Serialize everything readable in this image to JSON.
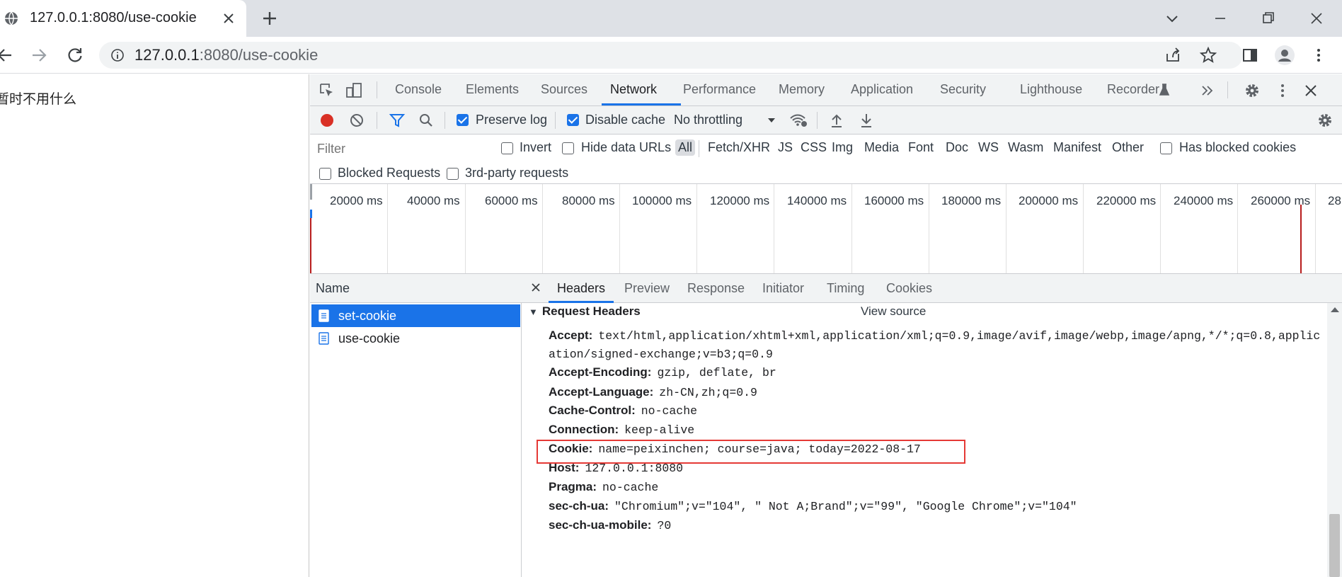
{
  "browser": {
    "tab_title": "127.0.0.1:8080/use-cookie",
    "url_host": "127.0.0.1",
    "url_rest": ":8080/use-cookie"
  },
  "page": {
    "text": "暂时不用什么"
  },
  "devtools": {
    "tabs": [
      "Console",
      "Elements",
      "Sources",
      "Network",
      "Performance",
      "Memory",
      "Application",
      "Security",
      "Lighthouse",
      "Recorder"
    ],
    "active_tab": "Network",
    "network_toolbar": {
      "preserve_log": "Preserve log",
      "disable_cache": "Disable cache",
      "throttling": "No throttling"
    },
    "filter": {
      "placeholder": "Filter",
      "invert": "Invert",
      "hide_data_urls": "Hide data URLs",
      "types": [
        "All",
        "Fetch/XHR",
        "JS",
        "CSS",
        "Img",
        "Media",
        "Font",
        "Doc",
        "WS",
        "Wasm",
        "Manifest",
        "Other"
      ],
      "has_blocked_cookies": "Has blocked cookies",
      "blocked_requests": "Blocked Requests",
      "third_party": "3rd-party requests"
    },
    "timeline": {
      "ticks": [
        "20000 ms",
        "40000 ms",
        "60000 ms",
        "80000 ms",
        "100000 ms",
        "120000 ms",
        "140000 ms",
        "160000 ms",
        "180000 ms",
        "200000 ms",
        "220000 ms",
        "240000 ms",
        "260000 ms",
        "28"
      ]
    },
    "requests": {
      "header": "Name",
      "items": [
        "set-cookie",
        "use-cookie"
      ]
    },
    "detail": {
      "tabs": [
        "Headers",
        "Preview",
        "Response",
        "Initiator",
        "Timing",
        "Cookies"
      ],
      "section_title": "Request Headers",
      "view_source": "View source",
      "headers": [
        {
          "key": "Accept:",
          "value": "text/html,application/xhtml+xml,application/xml;q=0.9,image/avif,image/webp,image/apng,*/*;q=0.8,applic"
        },
        {
          "key": "",
          "value": "ation/signed-exchange;v=b3;q=0.9"
        },
        {
          "key": "Accept-Encoding:",
          "value": "gzip, deflate, br"
        },
        {
          "key": "Accept-Language:",
          "value": "zh-CN,zh;q=0.9"
        },
        {
          "key": "Cache-Control:",
          "value": "no-cache"
        },
        {
          "key": "Connection:",
          "value": "keep-alive"
        },
        {
          "key": "Cookie:",
          "value": "name=peixinchen; course=java; today=2022-08-17"
        },
        {
          "key": "Host:",
          "value": "127.0.0.1:8080"
        },
        {
          "key": "Pragma:",
          "value": "no-cache"
        },
        {
          "key": "sec-ch-ua:",
          "value": "\"Chromium\";v=\"104\", \" Not A;Brand\";v=\"99\", \"Google Chrome\";v=\"104\""
        },
        {
          "key": "sec-ch-ua-mobile:",
          "value": "?0"
        }
      ]
    }
  }
}
